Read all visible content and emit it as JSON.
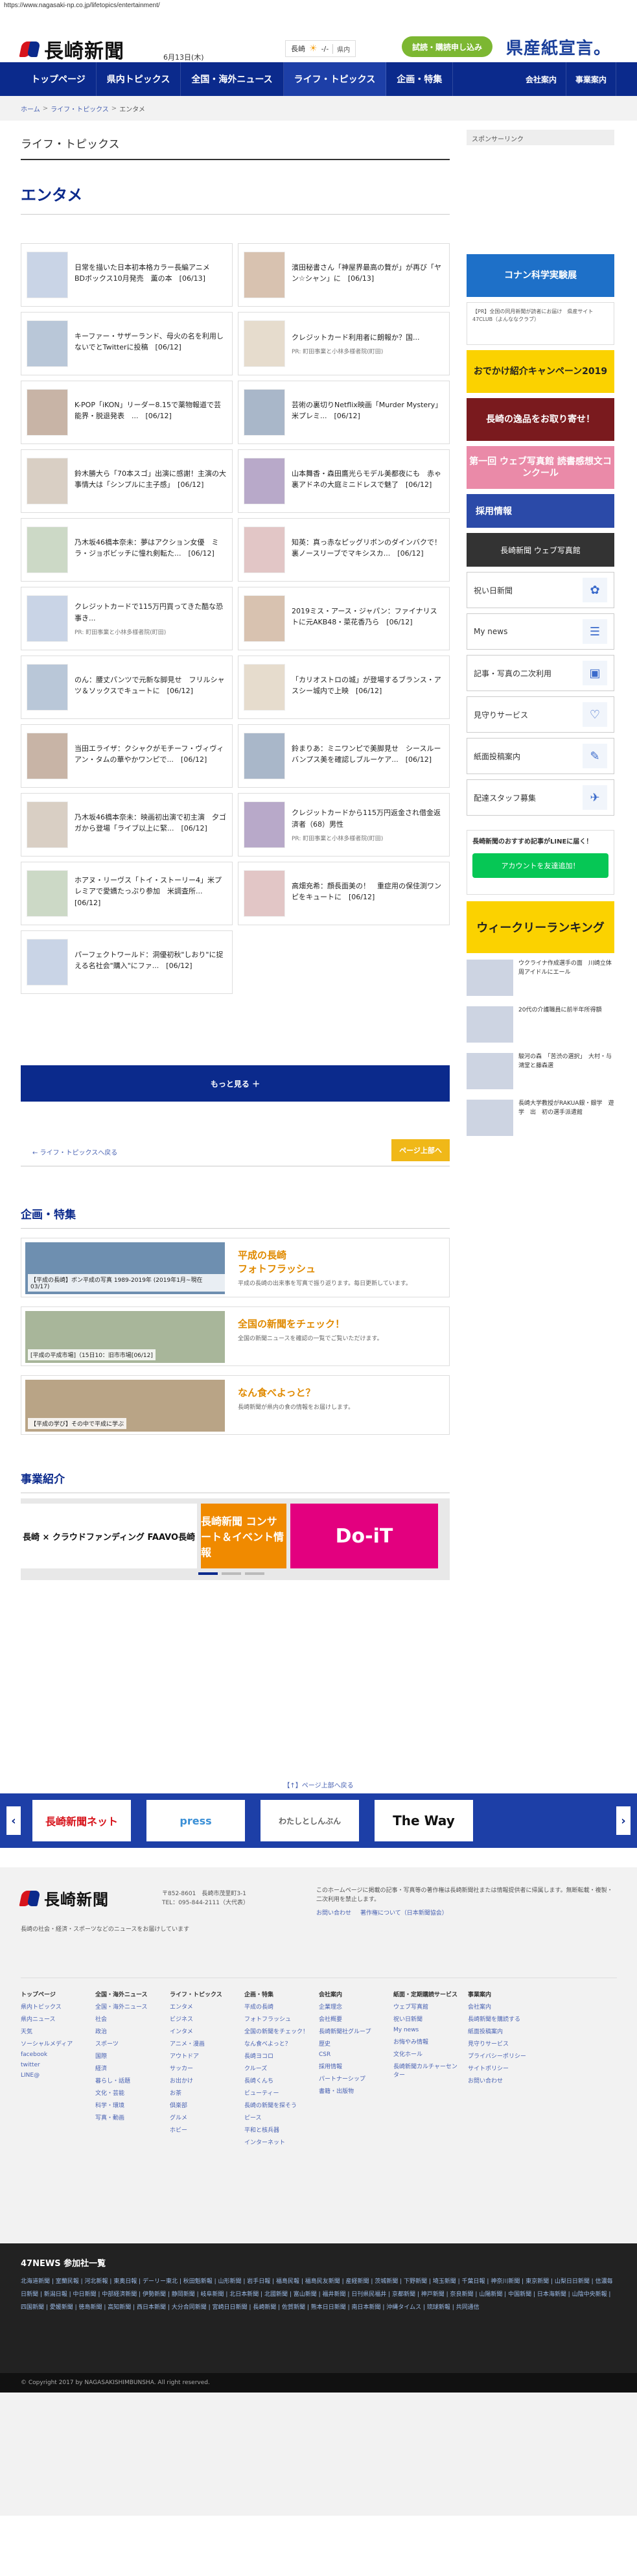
{
  "url": "https://www.nagasaki-np.co.jp/lifetopics/entertainment/",
  "header": {
    "logo_text": "長崎新聞",
    "date": "6月13日(木)",
    "weather_city": "長崎",
    "weather_temp": "-/-",
    "weather_link": "県内",
    "trial_label": "試読・購読申し込み",
    "ad_text": "県産紙宣言。"
  },
  "nav": {
    "items": [
      "トップページ",
      "県内トピックス",
      "全国・海外ニュース",
      "ライフ・トピックス",
      "企画・特集"
    ],
    "right_items": [
      "会社案内",
      "事業案内"
    ]
  },
  "breadcrumb": {
    "home": "ホーム",
    "parent": "ライフ・トピックス",
    "current": "エンタメ"
  },
  "main": {
    "category_title": "ライフ・トピックス",
    "page_title": "エンタメ",
    "articles": [
      {
        "text": "日常を描いた日本初本格カラー長編アニメ　BDボックス10月発売　薫の本　[06/13]",
        "pr": ""
      },
      {
        "text": "濱田秘書さん「神屋界最高の贅が」が再び「ヤン☆シャン」に　[06/13]",
        "pr": ""
      },
      {
        "text": "キーファー・サザーランド、母火の名を利用しないでとTwitterに投稿　[06/12]",
        "pr": ""
      },
      {
        "text": "クレジットカード利用者に朗報か？国...",
        "pr": "PR: 町田事業と小林多様者院(町田)"
      },
      {
        "text": "K-POP「iKON」リーダー8.15で薬物報道で芸能界・脱退発表　...　[06/12]",
        "pr": ""
      },
      {
        "text": "芸術の裏切りNetflix映画「Murder Mystery」米プレミ...　[06/12]",
        "pr": ""
      },
      {
        "text": "鈴木勝大ら「70本スゴ」出演に感謝！主演の大事情大は「シンプルに主子感」　[06/12]",
        "pr": ""
      },
      {
        "text": "山本舞香・森田鷹光らモデル美都夜にも　赤ゃ裏アドネの大庭ミニドレスで魅了　[06/12]",
        "pr": ""
      },
      {
        "text": "乃木坂46橋本奈未：夢はアクション女優　ミラ・ジョボビッチに憧れ剣転た...　[06/12]",
        "pr": ""
      },
      {
        "text": "知英：真っ赤なピッグリボンのダインバクで！　裏ノースリーブでマキシスカ...　[06/12]",
        "pr": ""
      },
      {
        "text": "クレジットカードで115万円買ってきた酷な恐事き...",
        "pr": "PR: 町田事業と小林多様者院(町田)"
      },
      {
        "text": "2019ミス・アース・ジャパン：ファイナリストに元AKB48・菜花香乃ら　[06/12]",
        "pr": ""
      },
      {
        "text": "のん：腰丈パンツで元新な脚見せ　フリルシャツ＆ソックスでキュートに　[06/12]",
        "pr": ""
      },
      {
        "text": "「カリオストロの城」が登場するブランス・アスシー城内で上映　[06/12]",
        "pr": ""
      },
      {
        "text": "当田エライザ：クシャクがモチーフ・ヴィヴィアン・タムの華やかワンピで...　[06/12]",
        "pr": ""
      },
      {
        "text": "鈴まりあ：ミニワンピで美脚見せ　シースルーバンプス美を確認しブルーケア...　[06/12]",
        "pr": ""
      },
      {
        "text": "乃木坂46橋本奈未：映画初出演で初主演　夕ゴガから登場「ライブ以上に緊...　[06/12]",
        "pr": ""
      },
      {
        "text": "クレジットカードから115万円返金され借金返済者（68）男性",
        "pr": "PR: 町田事業と小林多様者院(町田)"
      },
      {
        "text": "ホアヌ・リーヴス「トイ・ストーリー4」米プレミアで愛嬌たっぷり参加　米調査所...　[06/12]",
        "pr": ""
      },
      {
        "text": "高畑充希：顔長面美の！　重症用の保佳渕ワンピをキュートに　[06/12]",
        "pr": ""
      },
      {
        "text": "パーフェクトワールド：洞優初秋\"しおり\"に捉える名社会\"購入\"にファ...　[06/12]",
        "pr": ""
      }
    ],
    "more_label": "もっと見る ＋",
    "back_label": "← ライフ・トピックスへ戻る",
    "top_label": "ページ上部へ"
  },
  "features": {
    "title": "企画・特集",
    "items": [
      {
        "caption": "【平成の長崎】ボン平成の写真 1989-2019年 (2019年1月~現在 03/17)",
        "title": "平成の長崎\nフォトフラッシュ",
        "desc": "平成の長崎の出来事を写真で振り返ります。毎日更新しています。"
      },
      {
        "caption": "[平成の平成市場]（15日10：旧市市場[06/12]",
        "title": "全国の新聞をチェック！",
        "desc": "全国の新聞ニュースを確認の一覧でご覧いただけます。"
      },
      {
        "caption": "【平成の学び】その中で平成に学ぶ",
        "title": "なん食べよっと？",
        "desc": "長崎新聞が県内の食の情報をお届けします。"
      }
    ]
  },
  "business": {
    "title": "事業紹介",
    "slides": [
      "長崎 × クラウドファンディング FAAVO長崎",
      "長崎新聞 コンサート＆イベント情報",
      "Do-iT"
    ]
  },
  "sidebar": {
    "sponsor_label": "スポンサーリンク",
    "side_ad_text": "【PR】全国の同月新聞が読者にお届け　県産サイト 47CLUB（よんななクラブ）",
    "banners": [
      "コナン科学実験展",
      "おでかけ紹介キャンペーン2019",
      "長崎の逸品をお取り寄せ！",
      "第一回 ウェブ写真館 読書感想文コンクール"
    ],
    "recruit_label": "採用情報",
    "photo_label": "長崎新聞 ウェブ写真館",
    "buttons": [
      {
        "label": "祝い日新聞",
        "icon": "celebration-icon"
      },
      {
        "label": "My news",
        "icon": "news-icon"
      },
      {
        "label": "記事・写真の二次利用",
        "icon": "photo-icon"
      },
      {
        "label": "見守りサービス",
        "icon": "watch-icon"
      },
      {
        "label": "紙面投稿案内",
        "icon": "pen-icon"
      },
      {
        "label": "配達スタッフ募集",
        "icon": "delivery-icon"
      }
    ],
    "line_title": "長崎新聞のおすすめ記事がLINEに届く！",
    "line_button": "アカウントを友達追加！",
    "weekly_label": "ウィークリーランキング",
    "ranking": [
      "ウクライナ作成選手の面　川崎立体　周アイドルにエール",
      "20代の介護職員に前半年所得額",
      "駿河の森　「苦渋の選択」　大村・与鴻堂と藤森選",
      "長崎大学教授がRAKUA銀・銀学　遊学　出　初の選手派遣館"
    ]
  },
  "partners": {
    "label": "【↑】ページ上部へ戻る",
    "items": [
      "長崎新聞ネット",
      "press",
      "わたしとしんぶん",
      "The Way"
    ]
  },
  "footer": {
    "logo_text": "長崎新聞",
    "address": "〒852-8601　長崎市茂里町3-1\nTEL：095-844-2111（大代表）",
    "note": "長崎の社会・経済・スポーツなどのニュースをお届けしています",
    "right_text": "このホームページに掲載の記事・写真等の著作権は長崎新聞社または情報提供者に帰属します。無断転載・複製・二次利用を禁止します。",
    "links": [
      "お問い合わせ",
      "著作権について（日本新聞協会）"
    ],
    "columns": [
      {
        "head": "トップページ",
        "items": [
          "県内トピックス",
          "県内ニュース",
          "天気",
          "ソーシャルメディア",
          "facebook",
          "twitter",
          "LINE@"
        ]
      },
      {
        "head": "全国・海外ニュース",
        "items": [
          "全国・海外ニュース",
          "社会",
          "政治",
          "スポーツ",
          "国際",
          "経済",
          "暮らし・話題",
          "文化・芸能",
          "科学・環境",
          "写真・動画"
        ]
      },
      {
        "head": "ライフ・トピックス",
        "items": [
          "エンタメ",
          "ビジネス",
          "インタメ",
          "アニメ・漫画",
          "アウトドア",
          "サッカー",
          "お出かけ",
          "お茶",
          "倶楽部",
          "グルメ",
          "ホビー"
        ]
      },
      {
        "head": "企画・特集",
        "items": [
          "平成の長崎",
          "フォトフラッシュ",
          "全国の新聞をチェック！",
          "なん食べよっと？",
          "長崎ヨコロ",
          "クルーズ",
          "長崎くんち",
          "ビューティー",
          "長崎の新聞を探そう",
          "ピース",
          "平和と核兵器",
          "インターネット"
        ]
      },
      {
        "head": "会社案内",
        "items": [
          "企業理念",
          "会社概要",
          "長崎新聞社グループ",
          "歴史",
          "CSR",
          "採用情報",
          "パートナーシップ",
          "書籍・出版物"
        ]
      },
      {
        "head": "紙面・定期購読サービス",
        "items": [
          "ウェブ写真館",
          "祝い日新聞",
          "My news",
          "お悔やみ情報",
          "文化ホール",
          "長崎新聞カルチャーセンター"
        ]
      },
      {
        "head": "事業案内",
        "items": [
          "会社案内",
          "長崎新聞を購読する",
          "紙面投稿案内",
          "見守りサービス",
          "プライバシーポリシー",
          "サイトポリシー",
          "お問い合わせ"
        ]
      }
    ]
  },
  "news47": {
    "title": "47NEWS 参加社一覧",
    "list": "北海道新聞 | 室蘭民報 | 河北新報 | 東奥日報 | デーリー東北 | 秋田魁新報 | 山形新聞 | 岩手日報 | 福島民報 | 福島民友新聞 | 産経新聞 | 茨城新聞 | 下野新聞 | 埼玉新聞 | 千葉日報 | 神奈川新聞 | 東京新聞 | 山梨日日新聞 | 信濃毎日新聞 | 新潟日報 | 中日新聞 | 中部経済新聞 | 伊勢新聞 | 静岡新聞 | 岐阜新聞 | 北日本新聞 | 北國新聞 | 富山新聞 | 福井新聞 | 日刊県民福井 | 京都新聞 | 神戸新聞 | 奈良新聞 | 山陽新聞 | 中国新聞 | 日本海新聞 | 山陰中央新報 | 四国新聞 | 愛媛新聞 | 徳島新聞 | 高知新聞 | 西日本新聞 | 大分合同新聞 | 宮崎日日新聞 | 長崎新聞 | 佐賀新聞 | 熊本日日新聞 | 南日本新聞 | 沖縄タイムス | 琉球新報 | 共同通信"
  },
  "copyright": "© Copyright 2017 by NAGASAKISHIMBUNSHA.  All right reserved."
}
